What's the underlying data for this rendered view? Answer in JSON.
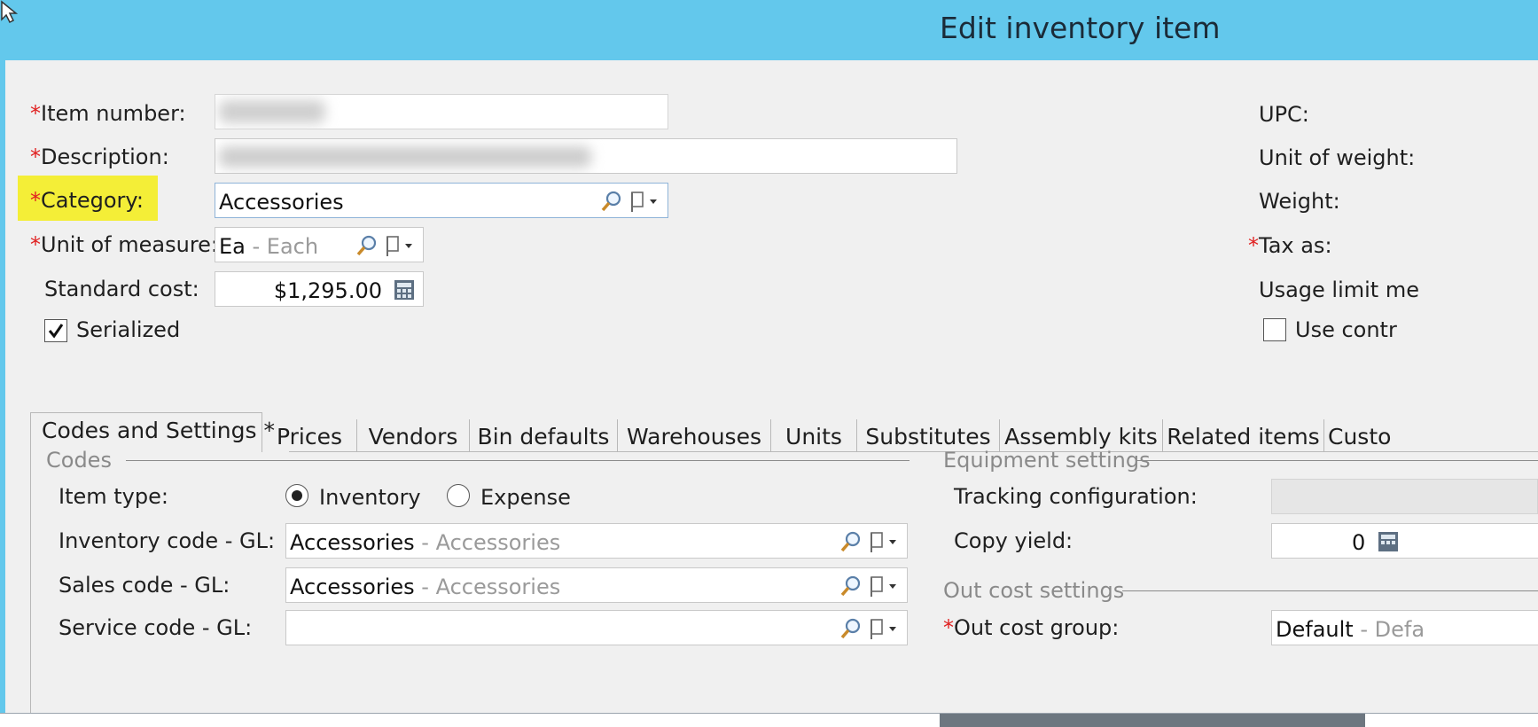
{
  "window": {
    "title": "Edit inventory item"
  },
  "header_form": {
    "item_number": {
      "label": "Item number:",
      "required": true
    },
    "description": {
      "label": "Description:",
      "required": true
    },
    "category": {
      "label": "Category:",
      "required": true,
      "value": "Accessories",
      "highlighted": true
    },
    "unit_of_measure": {
      "label": "Unit of measure:",
      "required": true,
      "code": "Ea",
      "desc": " - Each"
    },
    "standard_cost": {
      "label": "Standard cost:",
      "value": "$1,295.00"
    },
    "serialized": {
      "label": "Serialized",
      "checked": true
    }
  },
  "right_form": {
    "upc_label": "UPC:",
    "unit_of_weight_label": "Unit of weight:",
    "weight_label": "Weight:",
    "tax_as_label": "Tax as:",
    "usage_limit_label": "Usage limit me",
    "use_contract_label": "Use contr"
  },
  "tabs": [
    {
      "label": "Codes and Settings *",
      "active": true
    },
    {
      "label": "Prices"
    },
    {
      "label": "Vendors"
    },
    {
      "label": "Bin defaults"
    },
    {
      "label": "Warehouses"
    },
    {
      "label": "Units"
    },
    {
      "label": "Substitutes"
    },
    {
      "label": "Assembly kits"
    },
    {
      "label": "Related items"
    },
    {
      "label": "Custo"
    }
  ],
  "codes": {
    "group_label": "Codes",
    "item_type_label": "Item type:",
    "item_type_options": [
      "Inventory",
      "Expense"
    ],
    "item_type_selected": "Inventory",
    "inventory_code": {
      "label": "Inventory code - GL:",
      "code": "Accessories",
      "desc": " - Accessories"
    },
    "sales_code": {
      "label": "Sales code - GL:",
      "code": "Accessories",
      "desc": " - Accessories"
    },
    "service_code": {
      "label": "Service code - GL:",
      "code": ""
    }
  },
  "equipment": {
    "group_label": "Equipment settings",
    "tracking_label": "Tracking configuration:",
    "copy_yield_label": "Copy yield:",
    "copy_yield_value": "0"
  },
  "out_cost": {
    "group_label": "Out cost settings",
    "group_field_label": "Out cost group:",
    "group_code": "Default",
    "group_desc": " - Defa"
  },
  "colors": {
    "titlebar": "#63c8ec",
    "highlight": "#f4ee37",
    "required": "#e02020"
  }
}
